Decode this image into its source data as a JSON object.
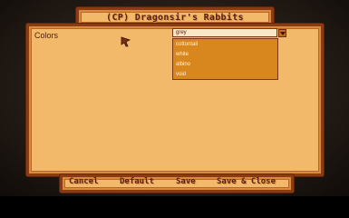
{
  "window": {
    "title": "(CP) Dragonsir's Rabbits"
  },
  "settings": {
    "colors_label": "Colors",
    "dropdown": {
      "selected": "grey",
      "options": [
        "cottontail",
        "white",
        "albino",
        "void"
      ]
    }
  },
  "bottom_bar": {
    "cancel_label": "Cancel",
    "default_label": "Default",
    "save_label": "Save",
    "save_close_label": "Save & Close"
  },
  "colors": {
    "panel": "#f2b96b",
    "border": "#8b3b14",
    "text": "#5a2110",
    "list_bg": "#d8861e"
  },
  "icons": {
    "cursor": "mouse-pointer-icon",
    "dropdown": "chevron-down-icon"
  }
}
